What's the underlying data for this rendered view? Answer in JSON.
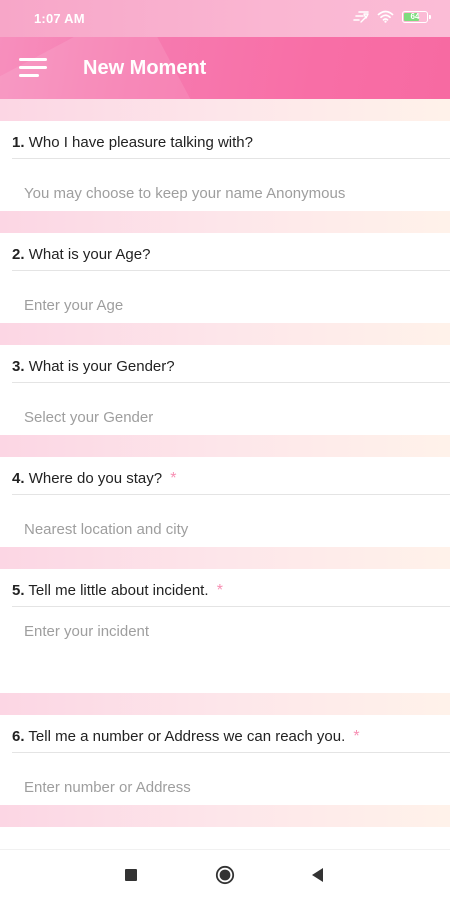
{
  "status_bar": {
    "time": "1:07 AM",
    "battery_level": "64",
    "icons": [
      "signal-icon",
      "wifi-icon",
      "battery-icon"
    ]
  },
  "app_bar": {
    "title": "New Moment",
    "menu_icon": "hamburger-menu-icon"
  },
  "colors": {
    "accent": "#f76aa2",
    "required": "#f78fb3",
    "strip": "#fde0e8"
  },
  "questions": [
    {
      "number": "1.",
      "label": "Who I have pleasure talking with?",
      "required": false,
      "placeholder": "You may choose to keep your name Anonymous",
      "value": ""
    },
    {
      "number": "2.",
      "label": "What is your Age?",
      "required": false,
      "placeholder": "Enter your Age",
      "value": ""
    },
    {
      "number": "3.",
      "label": "What is your Gender?",
      "required": false,
      "placeholder": "Select your Gender",
      "value": ""
    },
    {
      "number": "4.",
      "label": "Where do you stay?",
      "required": true,
      "placeholder": "Nearest location and city",
      "value": ""
    },
    {
      "number": "5.",
      "label": "Tell me little about incident.",
      "required": true,
      "placeholder": "Enter your incident",
      "value": ""
    },
    {
      "number": "6.",
      "label": "Tell me a number or Address we can reach you.",
      "required": true,
      "placeholder": "Enter number or Address",
      "value": ""
    }
  ],
  "required_mark": "*",
  "nav_bar": {
    "items": [
      "recent-apps-icon",
      "home-icon",
      "back-icon"
    ]
  }
}
